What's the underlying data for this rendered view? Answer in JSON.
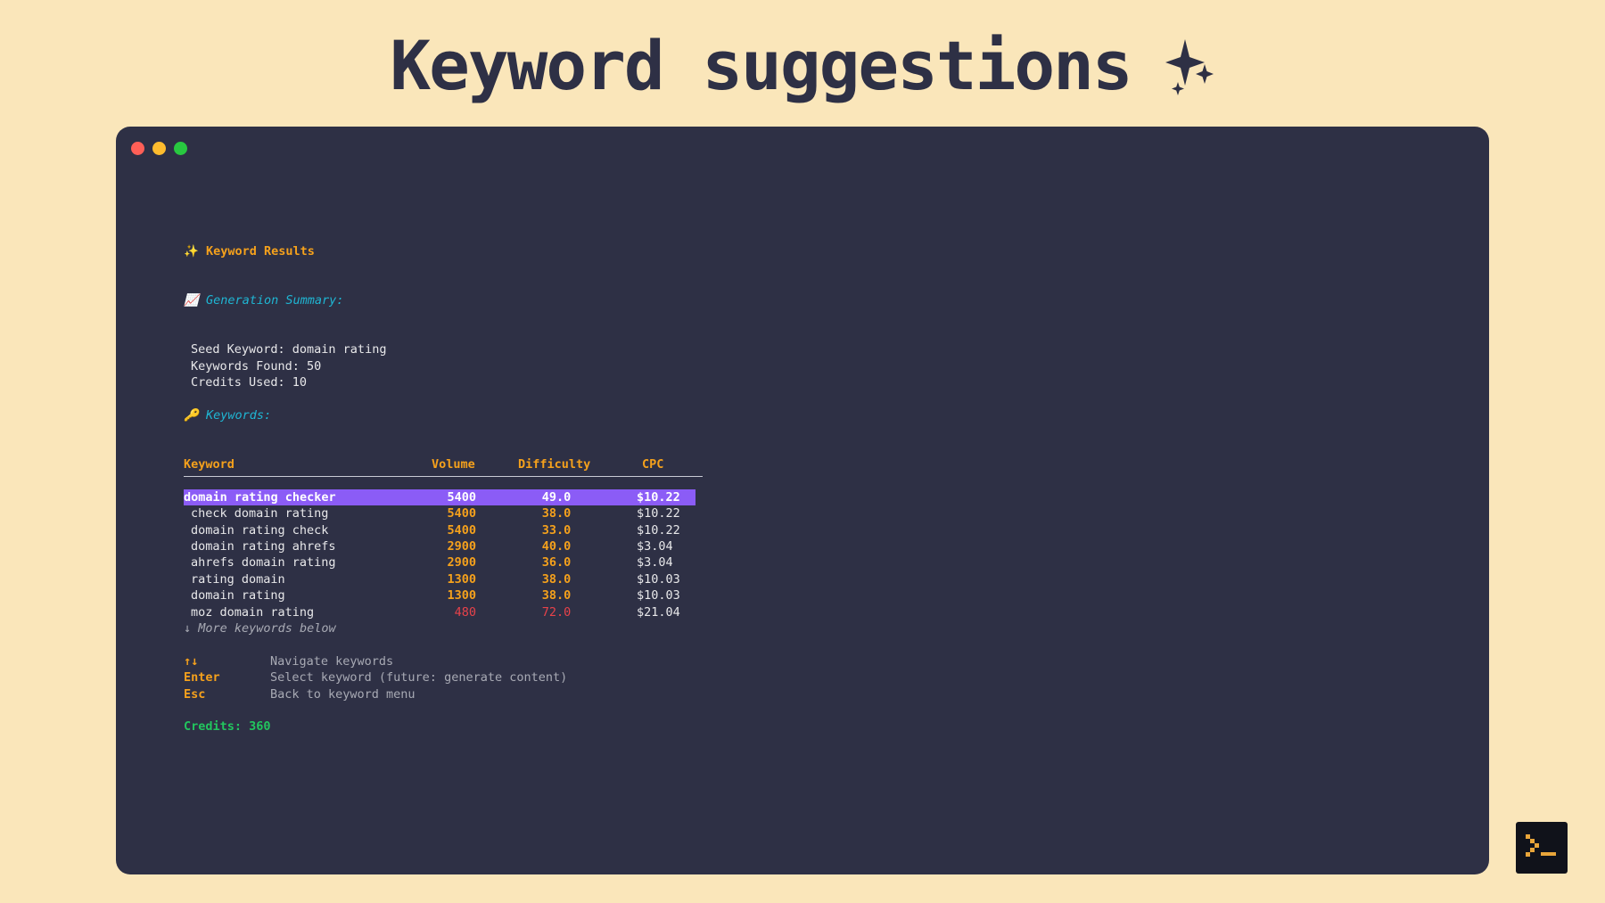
{
  "slide": {
    "title": "Keyword suggestions",
    "sparkle_icon": "sparkles-icon",
    "background": "#fae6ba"
  },
  "window": {
    "background": "#2e3045",
    "controls": [
      "close",
      "minimize",
      "maximize"
    ]
  },
  "terminal": {
    "results_heading": "Keyword Results",
    "summary_heading": "Generation Summary:",
    "summary": {
      "seed": "Seed Keyword: domain rating",
      "found": "Keywords Found: 50",
      "credits_used": "Credits Used: 10"
    },
    "keywords_heading": "Keywords:",
    "table": {
      "headers": [
        "Keyword",
        "Volume",
        "Difficulty",
        "CPC"
      ],
      "rows": [
        {
          "keyword": "domain rating checker",
          "volume": "5400",
          "difficulty": "49.0",
          "cpc": "$10.22",
          "selected": true
        },
        {
          "keyword": "check domain rating",
          "volume": "5400",
          "difficulty": "38.0",
          "cpc": "$10.22"
        },
        {
          "keyword": "domain rating check",
          "volume": "5400",
          "difficulty": "33.0",
          "cpc": "$10.22"
        },
        {
          "keyword": "domain rating ahrefs",
          "volume": "2900",
          "difficulty": "40.0",
          "cpc": "$3.04"
        },
        {
          "keyword": "ahrefs domain rating",
          "volume": "2900",
          "difficulty": "36.0",
          "cpc": "$3.04"
        },
        {
          "keyword": "rating domain",
          "volume": "1300",
          "difficulty": "38.0",
          "cpc": "$10.03"
        },
        {
          "keyword": "domain rating",
          "volume": "1300",
          "difficulty": "38.0",
          "cpc": "$10.03"
        },
        {
          "keyword": "moz domain rating",
          "volume": "480",
          "difficulty": "72.0",
          "cpc": "$21.04",
          "status": "high-difficulty"
        }
      ],
      "more_hint": "↓ More keywords below"
    },
    "help": [
      {
        "key": "↑↓",
        "desc": "Navigate keywords"
      },
      {
        "key": "Enter",
        "desc": "Select keyword (future: generate content)"
      },
      {
        "key": "Esc",
        "desc": "Back to keyword menu"
      }
    ],
    "credits": "Credits: 360"
  },
  "colors": {
    "accent_orange": "#f5a11c",
    "accent_cyan": "#1fb6d3",
    "selection": "#8b5cf6",
    "danger": "#e8424a",
    "credits_green": "#22c55e"
  }
}
